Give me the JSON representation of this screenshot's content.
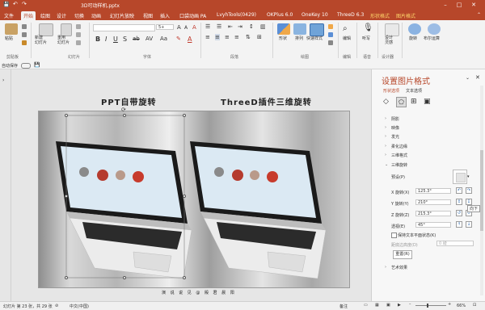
{
  "window": {
    "title": "3D可动样机.pptx"
  },
  "tabs": [
    {
      "label": "文件"
    },
    {
      "label": "开始"
    },
    {
      "label": "绘图"
    },
    {
      "label": "设计"
    },
    {
      "label": "切换"
    },
    {
      "label": "动画"
    },
    {
      "label": "幻灯片放映"
    },
    {
      "label": "视图"
    },
    {
      "label": "插入"
    },
    {
      "label": "口袋动画 PA"
    },
    {
      "label": "LvyhTools(0429)"
    },
    {
      "label": "OKPlus 6.0"
    },
    {
      "label": "OneKey 10"
    },
    {
      "label": "ThreeD 6.3"
    },
    {
      "label": "形状格式"
    },
    {
      "label": "图片格式"
    }
  ],
  "ribbon": {
    "groups": [
      {
        "label": "剪贴板"
      },
      {
        "label": "幻灯片"
      },
      {
        "label": "字体"
      },
      {
        "label": "段落"
      },
      {
        "label": "绘图"
      },
      {
        "label": "编辑"
      },
      {
        "label": "语音"
      },
      {
        "label": "设计器"
      }
    ],
    "paste": "粘贴",
    "new_slide": "新建\n幻灯片",
    "reuse": "重用\n幻灯片",
    "font_size_value": "5+",
    "shape": "形状",
    "arrange": "排列",
    "quick_styles": "快速样式",
    "edit": "编辑",
    "dictate": "听写",
    "design_ideas": "设计\n灵感",
    "rotate": "旋转",
    "rotate_sub": "布尔运算"
  },
  "qat": {
    "autosave": "自动保存"
  },
  "slide": {
    "title_left": "PPT自带旋转",
    "title_right": "ThreeD插件三维旋转",
    "footer": "演 说 说 见 @ 殿 君 晨 阳"
  },
  "pane": {
    "title": "设置图片格式",
    "tab_shape": "形状选项",
    "tab_text": "文本选项",
    "sections": [
      {
        "label": "阴影"
      },
      {
        "label": "映像"
      },
      {
        "label": "发光"
      },
      {
        "label": "柔化边缘"
      },
      {
        "label": "三维格式"
      },
      {
        "label": "三维旋转"
      }
    ],
    "preset_label": "预设(P)",
    "x_label": "X 旋转(X)",
    "x_value": "125.3°",
    "y_label": "Y 旋转(Y)",
    "y_value": "210°",
    "z_label": "Z 旋转(Z)",
    "z_value": "215.3°",
    "persp_label": "透视(E)",
    "persp_value": "45°",
    "keep_text": "保持文本平面状态(K)",
    "distance_label": "距底边高度(D)",
    "distance_value": "0 磅",
    "reset": "重置(R)",
    "art_effects": "艺术效果",
    "tooltip": "向下"
  },
  "status": {
    "slide": "幻灯片 第 23 张，共 29 张",
    "lang": "中文(中国)",
    "notes": "备注",
    "zoom": "66%"
  }
}
